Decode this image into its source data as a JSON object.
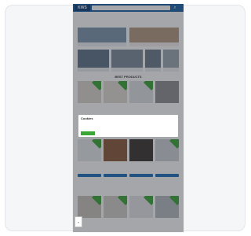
{
  "site": {
    "logo_text": "KWS",
    "search_placeholder": "",
    "header_links": [
      "",
      "",
      ""
    ]
  },
  "categories": [
    {
      "caption": ""
    },
    {
      "caption": ""
    },
    {
      "caption": ""
    },
    {
      "caption": ""
    },
    {
      "caption": ""
    },
    {
      "caption": ""
    }
  ],
  "sections": {
    "bestsellers_title": "BEST PRODUCTS"
  },
  "products": [
    {
      "name": "",
      "price": ""
    },
    {
      "name": "",
      "price": ""
    },
    {
      "name": "",
      "price": ""
    },
    {
      "name": "",
      "price": ""
    },
    {
      "name": "",
      "price": ""
    },
    {
      "name": "",
      "price": ""
    },
    {
      "name": "",
      "price": ""
    },
    {
      "name": "",
      "price": ""
    },
    {
      "name": "",
      "price": ""
    },
    {
      "name": "",
      "price": ""
    },
    {
      "name": "",
      "price": ""
    },
    {
      "name": "",
      "price": ""
    }
  ],
  "cookie_modal": {
    "title": "Cookies",
    "text": "",
    "accept_label": "",
    "settings_label": ""
  },
  "colors": {
    "brand_blue": "#1a63a8",
    "accent_green": "#3aa635",
    "overlay": "rgba(40,44,52,0.42)"
  }
}
